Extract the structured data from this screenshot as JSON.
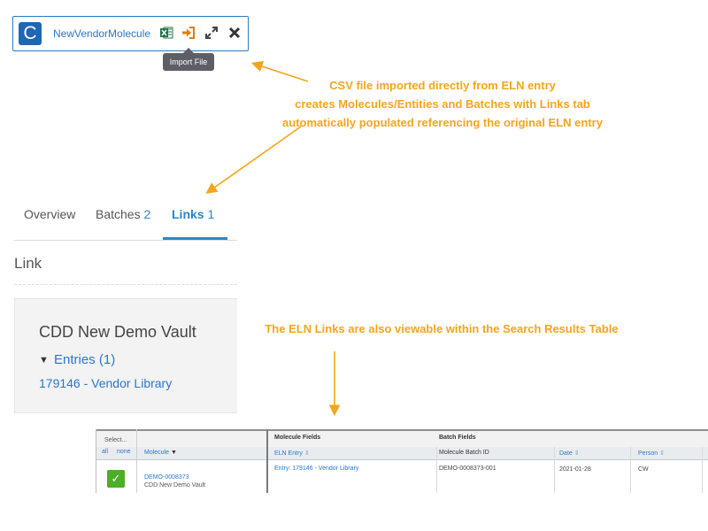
{
  "file_widget": {
    "avatar_letter": "C",
    "file_name": "NewVendorMolecule",
    "icons": [
      "excel-icon",
      "import-file-icon",
      "expand-icon",
      "close-icon"
    ],
    "tooltip": "Import File"
  },
  "callouts": {
    "import_line1": "CSV file imported directly from ELN entry",
    "import_line2": "creates Molecules/Entities and Batches with Links tab",
    "import_line3": "automatically populated referencing the original ELN entry",
    "search_results": "The ELN Links are also viewable within the Search Results Table",
    "color": "#f5a51b"
  },
  "tabs": [
    {
      "label": "Overview",
      "count": ""
    },
    {
      "label": "Batches",
      "count": "2"
    },
    {
      "label": "Links",
      "count": "1"
    }
  ],
  "link_section": {
    "heading": "Link",
    "vault_name": "CDD New Demo Vault",
    "entries_label": "Entries (1)",
    "entry": "179146 - Vendor Library"
  },
  "table": {
    "select_label": "Select...",
    "select_all": "all",
    "select_none": "none",
    "molecule_header": "Molecule",
    "group_molecule_fields": "Molecule Fields",
    "group_batch_fields": "Batch Fields",
    "columns": [
      "ELN Entry",
      "Molecule Batch ID",
      "Date",
      "Person"
    ],
    "row": {
      "molecule_id": "DEMO-0008373",
      "vault": "CDD New Demo Vault",
      "eln_entry": "Entry: 179146 - Vendor Library",
      "batch_id": "DEMO-0008373-001",
      "date": "2021-01-28",
      "person": "CW"
    }
  }
}
